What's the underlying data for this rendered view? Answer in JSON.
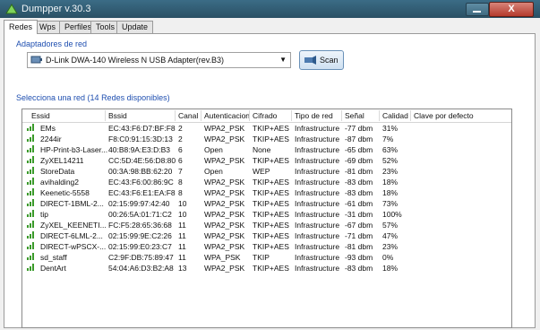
{
  "window": {
    "title": "Dumpper v.30.3",
    "close": "X"
  },
  "tabs": [
    "Redes",
    "Wps",
    "Perfiles",
    "Tools",
    "Update"
  ],
  "adapters": {
    "label": "Adaptadores de red",
    "selected": "D-Link DWA-140 Wireless N USB Adapter(rev.B3)",
    "scan_label": "Scan"
  },
  "networks": {
    "label": "Selecciona una red (14 Redes disponibles)",
    "columns": [
      "Essid",
      "Bssid",
      "Canal",
      "Autenticacion",
      "Cifrado",
      "Tipo de red",
      "Señal",
      "Calidad",
      "Clave por defecto"
    ],
    "rows": [
      {
        "essid": "EMs",
        "bssid": "EC:43:F6:D7:BF:F8",
        "canal": "2",
        "auth": "WPA2_PSK",
        "cifrado": "TKIP+AES",
        "tipo": "Infrastructure",
        "senal": "-77 dbm",
        "calidad": "31%",
        "clave": ""
      },
      {
        "essid": "2244ir",
        "bssid": "F8:C0:91:15:3D:13",
        "canal": "2",
        "auth": "WPA2_PSK",
        "cifrado": "TKIP+AES",
        "tipo": "Infrastructure",
        "senal": "-87 dbm",
        "calidad": "7%",
        "clave": ""
      },
      {
        "essid": "HP-Print-b3-Laser...",
        "bssid": "40:B8:9A:E3:D:B3",
        "canal": "6",
        "auth": "Open",
        "cifrado": "None",
        "tipo": "Infrastructure",
        "senal": "-65 dbm",
        "calidad": "63%",
        "clave": ""
      },
      {
        "essid": "ZyXEL14211",
        "bssid": "CC:5D:4E:56:D8:80",
        "canal": "6",
        "auth": "WPA2_PSK",
        "cifrado": "TKIP+AES",
        "tipo": "Infrastructure",
        "senal": "-69 dbm",
        "calidad": "52%",
        "clave": ""
      },
      {
        "essid": "StoreData",
        "bssid": "00:3A:98:BB:62:20",
        "canal": "7",
        "auth": "Open",
        "cifrado": "WEP",
        "tipo": "Infrastructure",
        "senal": "-81 dbm",
        "calidad": "23%",
        "clave": ""
      },
      {
        "essid": "avihalding2",
        "bssid": "EC:43:F6:00:86:9C",
        "canal": "8",
        "auth": "WPA2_PSK",
        "cifrado": "TKIP+AES",
        "tipo": "Infrastructure",
        "senal": "-83 dbm",
        "calidad": "18%",
        "clave": ""
      },
      {
        "essid": "Keenetic-5558",
        "bssid": "EC:43:F6:E1:EA:F8",
        "canal": "8",
        "auth": "WPA2_PSK",
        "cifrado": "TKIP+AES",
        "tipo": "Infrastructure",
        "senal": "-83 dbm",
        "calidad": "18%",
        "clave": ""
      },
      {
        "essid": "DIRECT-1BML-2...",
        "bssid": "02:15:99:97:42:40",
        "canal": "10",
        "auth": "WPA2_PSK",
        "cifrado": "TKIP+AES",
        "tipo": "Infrastructure",
        "senal": "-61 dbm",
        "calidad": "73%",
        "clave": ""
      },
      {
        "essid": "tip",
        "bssid": "00:26:5A:01:71:C2",
        "canal": "10",
        "auth": "WPA2_PSK",
        "cifrado": "TKIP+AES",
        "tipo": "Infrastructure",
        "senal": "-31 dbm",
        "calidad": "100%",
        "clave": ""
      },
      {
        "essid": "ZyXEL_KEENETI...",
        "bssid": "FC:F5:28:65:36:68",
        "canal": "11",
        "auth": "WPA2_PSK",
        "cifrado": "TKIP+AES",
        "tipo": "Infrastructure",
        "senal": "-67 dbm",
        "calidad": "57%",
        "clave": ""
      },
      {
        "essid": "DIRECT-6LML-2...",
        "bssid": "02:15:99:9E:C2:26",
        "canal": "11",
        "auth": "WPA2_PSK",
        "cifrado": "TKIP+AES",
        "tipo": "Infrastructure",
        "senal": "-71 dbm",
        "calidad": "47%",
        "clave": ""
      },
      {
        "essid": "DIRECT-wPSCX-...",
        "bssid": "02:15:99:E0:23:C7",
        "canal": "11",
        "auth": "WPA2_PSK",
        "cifrado": "TKIP+AES",
        "tipo": "Infrastructure",
        "senal": "-81 dbm",
        "calidad": "23%",
        "clave": ""
      },
      {
        "essid": "sd_staff",
        "bssid": "C2:9F:DB:75:89:47",
        "canal": "11",
        "auth": "WPA_PSK",
        "cifrado": "TKIP",
        "tipo": "Infrastructure",
        "senal": "-93 dbm",
        "calidad": "0%",
        "clave": ""
      },
      {
        "essid": "DentArt",
        "bssid": "54:04:A6:D3:B2:A8",
        "canal": "13",
        "auth": "WPA2_PSK",
        "cifrado": "TKIP+AES",
        "tipo": "Infrastructure",
        "senal": "-83 dbm",
        "calidad": "18%",
        "clave": ""
      }
    ]
  },
  "colors": {
    "titlebar": "#2a5064",
    "section_label": "#1f4fb0",
    "signal_bars": "#3a9a2a"
  }
}
